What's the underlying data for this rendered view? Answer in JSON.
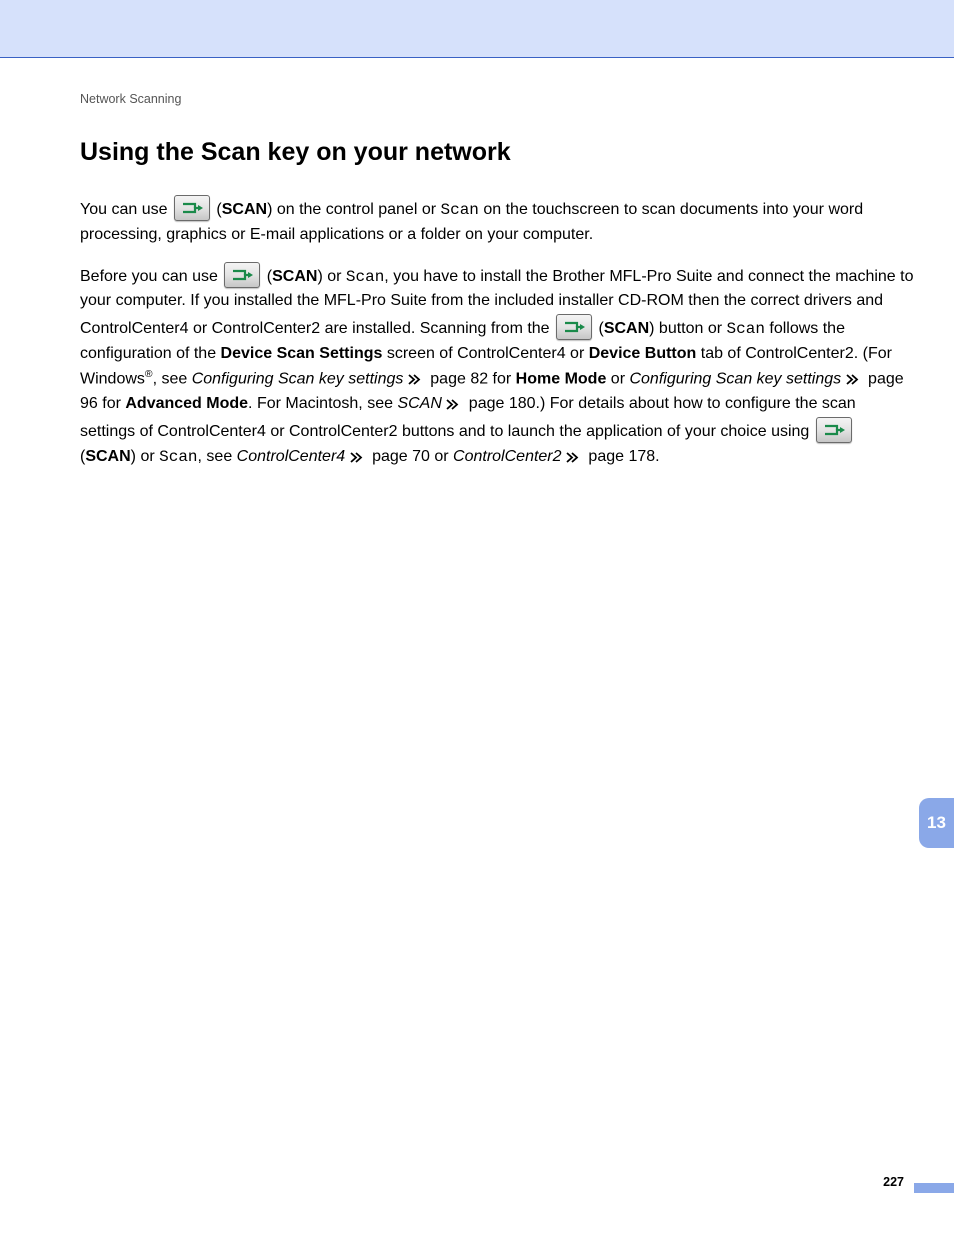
{
  "section": "Network Scanning",
  "heading": "Using the Scan key on your network",
  "labels": {
    "scan_bold": "SCAN",
    "scan_mono": "Scan"
  },
  "p1": {
    "t1": "You can use ",
    "t2": " (",
    "t3": ") on the control panel or ",
    "t4": " on the touchscreen to scan documents into your word processing, graphics or E-mail applications or a folder on your computer."
  },
  "p2": {
    "t1": "Before you can use ",
    "t2": " (",
    "t3": ") or ",
    "t4": ", you have to install the Brother MFL-Pro Suite and connect the machine to your computer. If you installed the MFL-Pro Suite from the included installer CD-ROM then the correct drivers and ControlCenter4 or ControlCenter2 are installed. Scanning from the ",
    "t5": " (",
    "t6": ") button or ",
    "t7": " follows the configuration of the ",
    "device_scan": "Device Scan Settings",
    "t8": " screen of ControlCenter4 or ",
    "device_button": "Device Button",
    "t9": " tab of ControlCenter2. (For Windows",
    "reg": "®",
    "t10": ", see ",
    "link1": "Configuring Scan key settings",
    "t11": " page 82 for ",
    "home_mode": "Home Mode",
    "t12": " or ",
    "link2": "Configuring Scan key settings",
    "t13": " page 96 for ",
    "adv_mode": "Advanced Mode",
    "t14": ". For Macintosh, see ",
    "link3": "SCAN",
    "t15": " page 180.) For details about how to configure the scan settings of ControlCenter4 or ControlCenter2 buttons and to launch the application of your choice using ",
    "t16": " (",
    "t17": ") or ",
    "t18": ", see ",
    "link4": "ControlCenter4",
    "t19": " page 70 or ",
    "link5": "ControlCenter2",
    "t20": " page 178."
  },
  "thumb_tab": "13",
  "page_number": "227"
}
